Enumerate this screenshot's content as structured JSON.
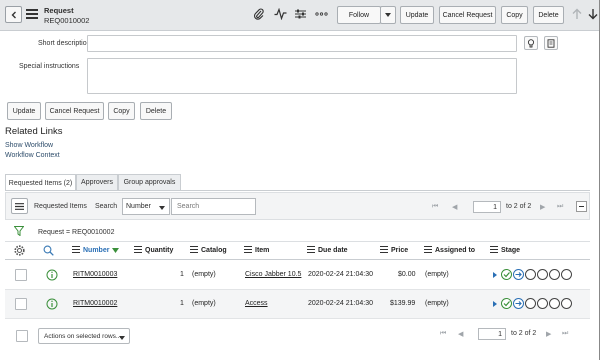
{
  "header": {
    "title": "Request",
    "number": "REQ0010002",
    "follow_label": "Follow",
    "update_label": "Update",
    "cancel_label": "Cancel Request",
    "copy_label": "Copy",
    "delete_label": "Delete"
  },
  "form": {
    "short_description_label": "Short description",
    "short_description_value": "",
    "special_instructions_label": "Special instructions",
    "special_instructions_value": ""
  },
  "actions": {
    "update_label": "Update",
    "cancel_label": "Cancel Request",
    "copy_label": "Copy",
    "delete_label": "Delete"
  },
  "related_links": {
    "title": "Related Links",
    "links": [
      "Show Workflow",
      "Workflow Context"
    ]
  },
  "tabs": [
    "Requested Items (2)",
    "Approvers",
    "Group approvals"
  ],
  "list": {
    "title": "Requested Items",
    "search_label": "Search",
    "search_field": "Number",
    "search_placeholder": "Search",
    "page": "1",
    "page_total": "to 2 of 2",
    "filter_text": "Request = REQ0010002",
    "columns": [
      "Number",
      "Quantity",
      "Catalog",
      "Item",
      "Due date",
      "Price",
      "Assigned to",
      "Stage"
    ],
    "rows": [
      {
        "number": "RITM0010003",
        "quantity": "1",
        "catalog": "(empty)",
        "item": "Cisco Jabber 10.5",
        "due_date": "2020-02-24 21:04:30",
        "price": "$0.00",
        "assigned_to": "(empty)"
      },
      {
        "number": "RITM0010002",
        "quantity": "1",
        "catalog": "(empty)",
        "item": "Access",
        "due_date": "2020-02-24 21:04:30",
        "price": "$139.99",
        "assigned_to": "(empty)"
      }
    ],
    "actions_placeholder": "Actions on selected rows...",
    "footer_page": "1",
    "footer_total": "to 2 of 2"
  },
  "icons": {
    "back": "chevron-left-icon",
    "menu": "hamburger-icon",
    "attachment": "paperclip-icon",
    "activity": "activity-icon",
    "settings": "sliders-icon",
    "more": "more-icon",
    "up": "arrow-up-icon",
    "down": "arrow-down-icon"
  }
}
